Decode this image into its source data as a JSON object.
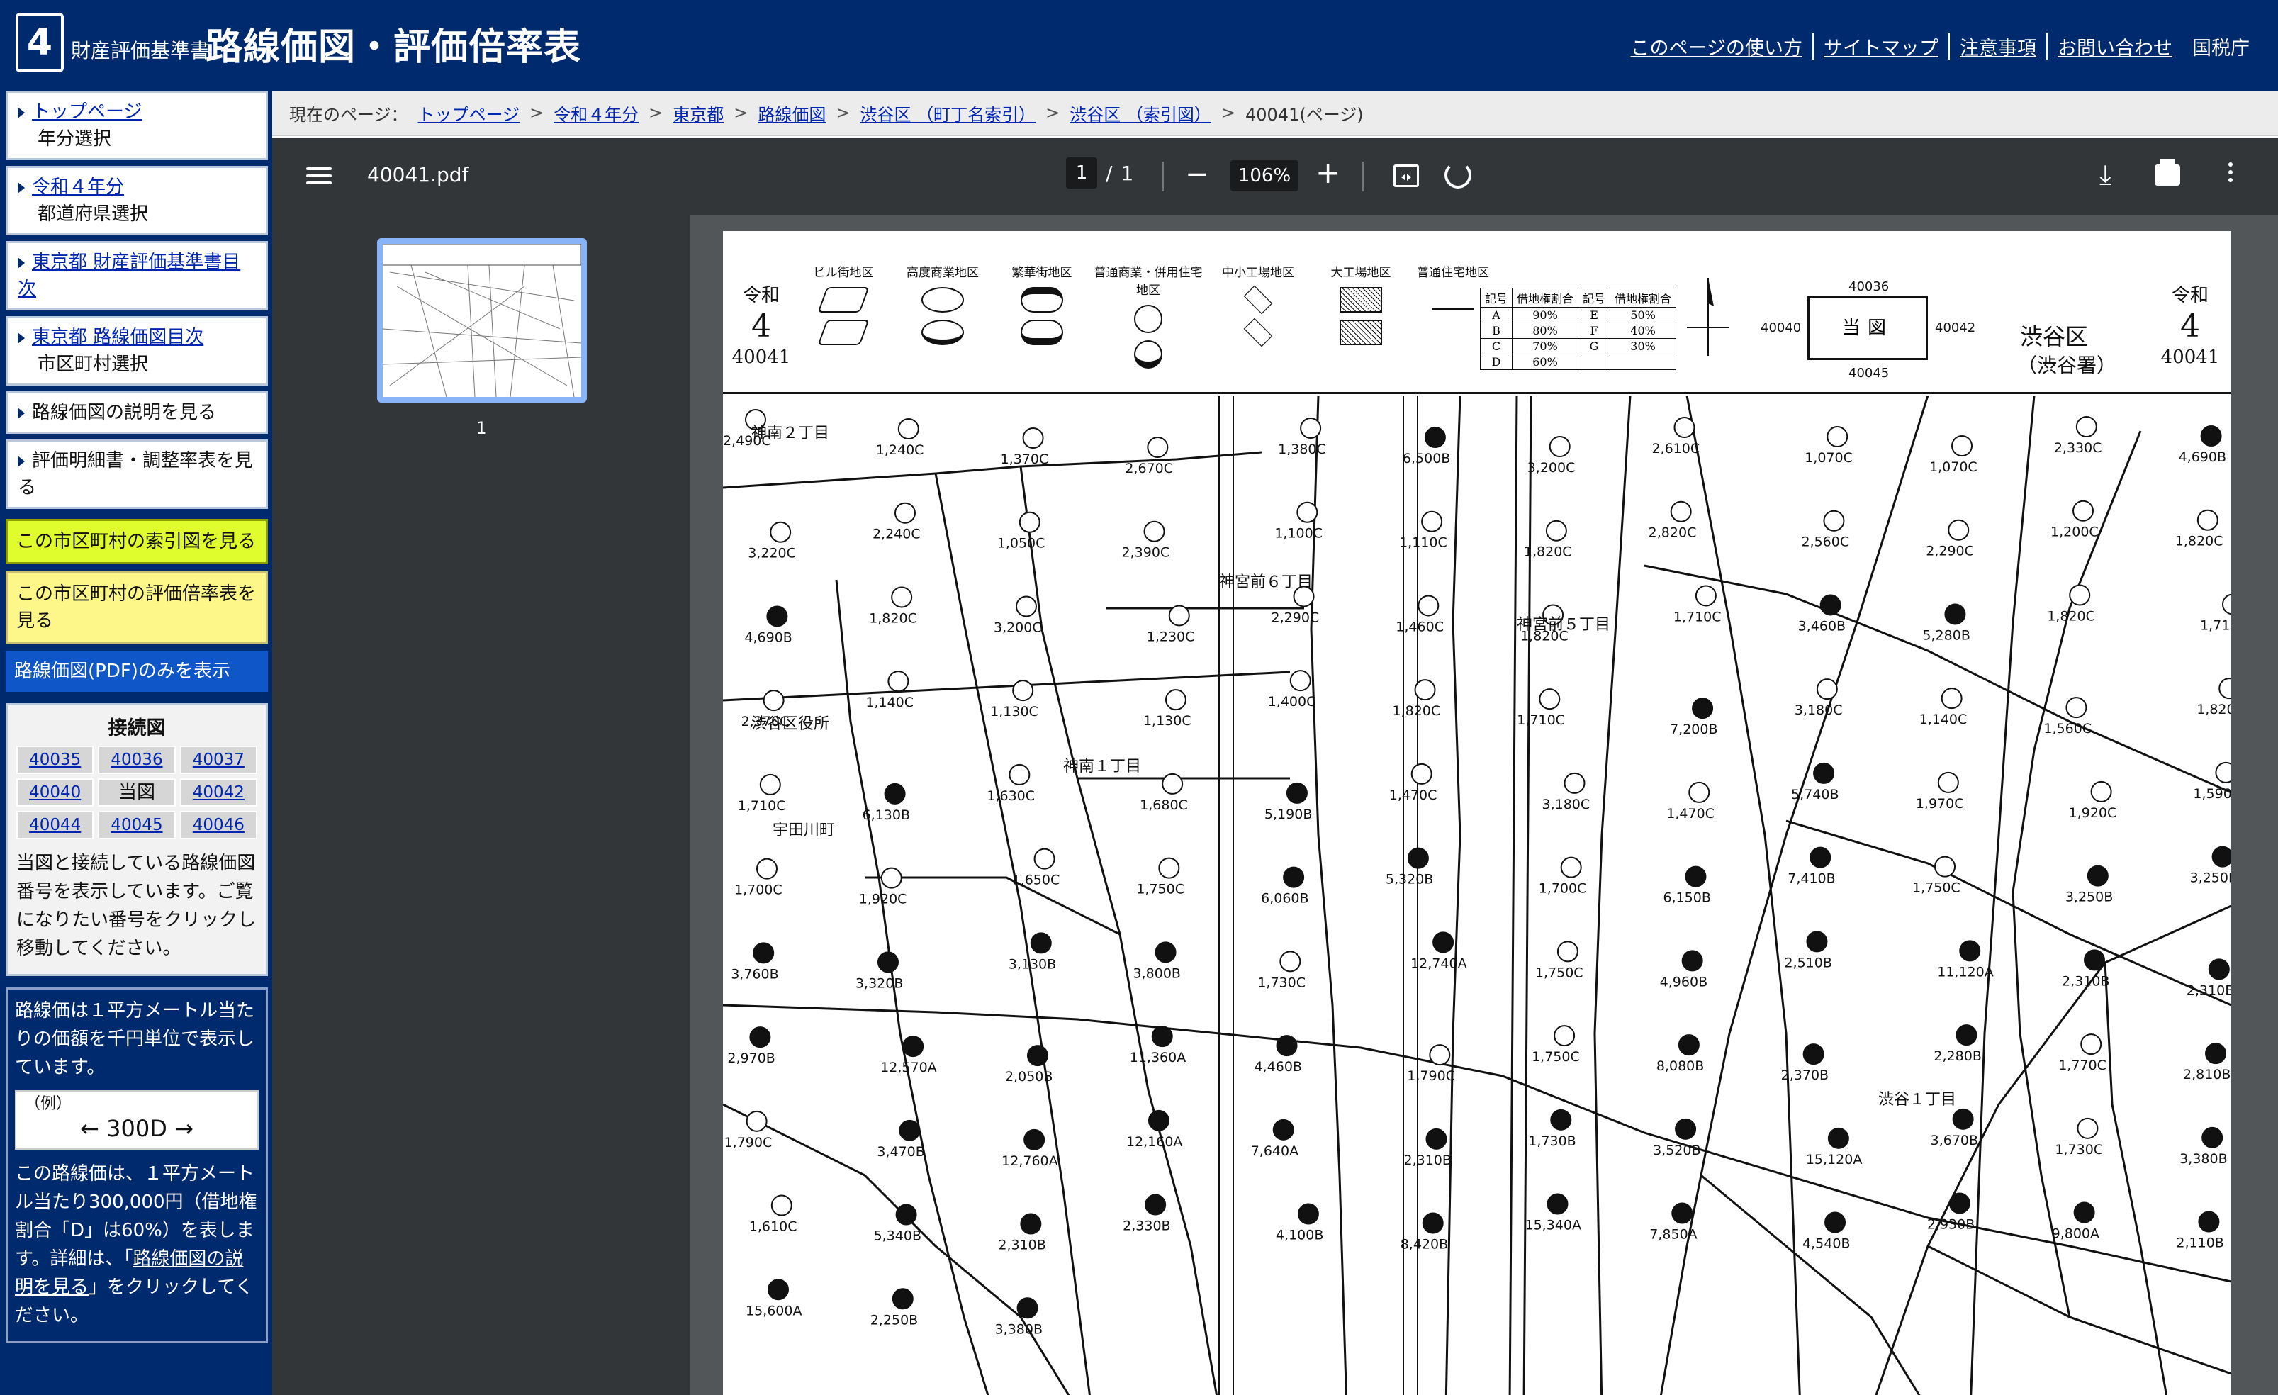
{
  "header": {
    "logo_number": "4",
    "subtitle": "財産評価基準書",
    "title": "路線価図・評価倍率表",
    "links": [
      "このページの使い方",
      "サイトマップ",
      "注意事項",
      "お問い合わせ"
    ],
    "agency": "国税庁"
  },
  "sidebar": {
    "items": [
      {
        "link": "トップページ",
        "sub": "年分選択"
      },
      {
        "link": "令和４年分",
        "sub": "都道府県選択"
      },
      {
        "link": "東京都 財産評価基準書目次",
        "sub": ""
      },
      {
        "link": "東京都 路線価図目次",
        "sub": "市区町村選択"
      }
    ],
    "plain_items": [
      "路線価図の説明を見る",
      "評価明細書・調整率表を見る"
    ],
    "index_map": "この市区町村の索引図を見る",
    "rate_table": "この市区町村の評価倍率表を見る",
    "pdf_only": "路線価図(PDF)のみを表示",
    "connect": {
      "title": "接続図",
      "cells": [
        "40035",
        "40036",
        "40037",
        "40040",
        "当図",
        "40042",
        "40044",
        "40045",
        "40046"
      ],
      "desc": "当図と接続している路線価図番号を表示しています。ご覧になりたい番号をクリックし移動してください。"
    },
    "note": {
      "intro": "路線価は１平方メートル当たりの価額を千円単位で表示しています。",
      "example_label": "（例）",
      "example_value": "← 300D →",
      "desc_before": "この路線価は、１平方メートル当たり300,000円（借地権割合「D」は60%）を表します。詳細は、「",
      "desc_link": "路線価図の説明を見る",
      "desc_after": "」をクリックしてください。"
    }
  },
  "breadcrumb": {
    "prefix": "現在のページ：",
    "links": [
      "トップページ",
      "令和４年分",
      "東京都",
      "路線価図",
      "渋谷区 （町丁名索引）",
      "渋谷区 （索引図）"
    ],
    "current": "40041(ページ)"
  },
  "viewer": {
    "file_name": "40041.pdf",
    "page_current": "1",
    "page_total": "1",
    "zoom": "106%",
    "thumb_label": "1"
  },
  "map": {
    "reiwa": "令和",
    "year": "4",
    "sheet": "40041",
    "legend": [
      "ビル街地区",
      "高度商業地区",
      "繁華街地区",
      "普通商業・併用住宅地区",
      "中小工場地区",
      "大工場地区",
      "普通住宅地区"
    ],
    "rate_header": [
      "記号",
      "借地権割合",
      "記号",
      "借地権割合"
    ],
    "rates": [
      [
        "A",
        "90%",
        "E",
        "50%"
      ],
      [
        "B",
        "80%",
        "F",
        "40%"
      ],
      [
        "C",
        "70%",
        "G",
        "30%"
      ],
      [
        "D",
        "60%",
        "",
        ""
      ]
    ],
    "locator_center": "当図",
    "locator_top": "40036",
    "locator_left": "40040",
    "locator_right": "40042",
    "locator_bottom": "40045",
    "ward": "渋谷区",
    "office": "（渋谷署）",
    "place_labels": [
      "神南２丁目",
      "渋谷区役所",
      "宇田川町",
      "神南１丁目",
      "神宮前６丁目",
      "神宮前５丁目",
      "渋谷１丁目"
    ],
    "prices": [
      "2,490C",
      "1,240C",
      "1,370C",
      "2,670C",
      "1,380C",
      "6,500B",
      "3,200C",
      "2,610C",
      "1,070C",
      "1,070C",
      "2,330C",
      "4,690B",
      "3,220C",
      "2,240C",
      "1,050C",
      "2,390C",
      "1,100C",
      "1,110C",
      "1,820C",
      "2,820C",
      "2,560C",
      "2,290C",
      "1,200C",
      "1,820C",
      "4,690B",
      "1,820C",
      "3,200C",
      "1,230C",
      "2,290C",
      "1,460C",
      "1,820C",
      "1,710C",
      "3,460B",
      "5,280B",
      "1,820C",
      "1,710C",
      "2,370C",
      "1,140C",
      "1,130C",
      "1,130C",
      "1,400C",
      "1,820C",
      "1,710C",
      "7,200B",
      "3,180C",
      "1,140C",
      "1,560C",
      "1,820C",
      "1,710C",
      "6,130B",
      "1,630C",
      "1,680C",
      "5,190B",
      "1,470C",
      "3,180C",
      "1,470C",
      "5,740B",
      "1,970C",
      "1,920C",
      "1,590C",
      "1,700C",
      "1,920C",
      "1,650C",
      "1,750C",
      "6,060B",
      "5,320B",
      "1,700C",
      "6,150B",
      "7,410B",
      "1,750C",
      "3,250B",
      "3,250B",
      "3,760B",
      "3,320B",
      "3,130B",
      "3,800B",
      "1,730C",
      "12,740A",
      "1,750C",
      "4,960B",
      "2,510B",
      "11,120A",
      "2,310B",
      "2,310B",
      "2,970B",
      "12,570A",
      "2,050B",
      "11,360A",
      "4,460B",
      "1,790C",
      "1,750C",
      "8,080B",
      "2,370B",
      "2,280B",
      "1,770C",
      "2,810B",
      "1,790C",
      "3,470B",
      "12,760A",
      "12,160A",
      "7,640A",
      "2,310B",
      "1,730B",
      "3,520B",
      "15,120A",
      "3,670B",
      "1,730C",
      "3,380B",
      "1,610C",
      "5,340B",
      "2,310B",
      "2,330B",
      "4,100B",
      "8,420B",
      "15,340A",
      "7,850A",
      "4,540B",
      "2,930B",
      "9,800A",
      "2,110B",
      "15,600A",
      "2,250B",
      "3,380B"
    ]
  }
}
